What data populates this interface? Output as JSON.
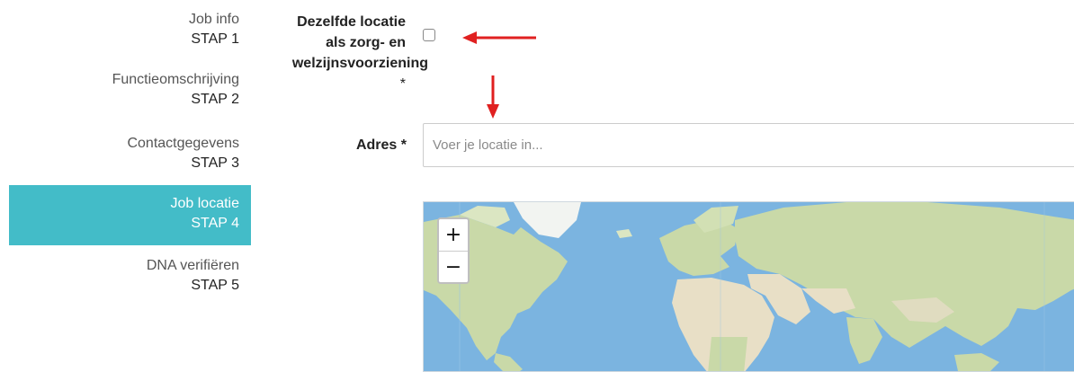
{
  "steps": [
    {
      "name": "Job info",
      "num": "STAP 1"
    },
    {
      "name": "Functieomschrijving",
      "num": "STAP 2"
    },
    {
      "name": "Contactgegevens",
      "num": "STAP 3"
    },
    {
      "name": "Job locatie",
      "num": "STAP 4"
    },
    {
      "name": "DNA verifiëren",
      "num": "STAP 5"
    }
  ],
  "active_step": 4,
  "form": {
    "same_location": {
      "label_line1": "Dezelfde locatie",
      "label_line2": "als zorg- en",
      "label_line3": "welzijnsvoorziening",
      "required_mark": "*",
      "checked": false
    },
    "address": {
      "label": "Adres *",
      "value": "",
      "placeholder": "Voer je locatie in..."
    }
  },
  "map": {
    "zoom_in_label": "+",
    "zoom_out_label": "−"
  },
  "colors": {
    "active_step_bg": "#43bcc8",
    "annotation_arrow": "#e02020",
    "ocean": "#7bb4e0",
    "land": "#c9d9a8"
  }
}
